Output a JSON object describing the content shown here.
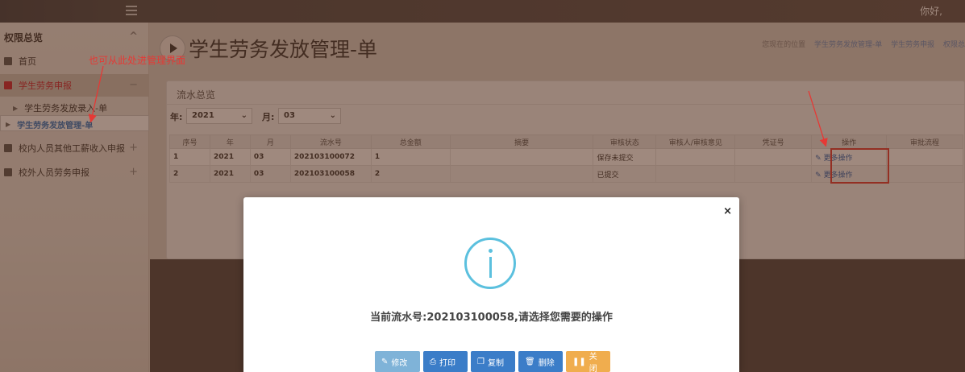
{
  "topbar": {
    "greeting": "你好,"
  },
  "sidebar": {
    "section_title": "权限总览",
    "items": [
      {
        "label": "首页"
      },
      {
        "label": "学生劳务申报"
      },
      {
        "label": "学生劳务发放录入-单"
      },
      {
        "label": "学生劳务发放管理-单"
      },
      {
        "label": "校内人员其他工薪收入申报"
      },
      {
        "label": "校外人员劳务申报"
      }
    ],
    "collapse_symbol": "^",
    "minus_symbol": "−",
    "plus_symbol": "+"
  },
  "annotation": {
    "text": "也可从此处进管理界面"
  },
  "header": {
    "title": "学生劳务发放管理-单",
    "location_label": "您现在的位置",
    "breadcrumbs": [
      "学生劳务发放管理-单",
      "学生劳务申报",
      "权限总"
    ]
  },
  "panel": {
    "title": "流水总览",
    "year_label": "年:",
    "year_value": "2021",
    "month_label": "月:",
    "month_value": "03"
  },
  "table": {
    "headers": [
      "序号",
      "年",
      "月",
      "流水号",
      "总金额",
      "摘要",
      "审核状态",
      "审核人/审核意见",
      "凭证号",
      "操作",
      "审批流程"
    ],
    "rows": [
      [
        "1",
        "2021",
        "03",
        "202103100072",
        "1",
        "",
        "保存未提交",
        "",
        "",
        "更多操作",
        ""
      ],
      [
        "2",
        "2021",
        "03",
        "202103100058",
        "2",
        "",
        "已提交",
        "",
        "",
        "更多操作",
        ""
      ]
    ]
  },
  "modal": {
    "close": "×",
    "message": "当前流水号:202103100058,请选择您需要的操作",
    "buttons": {
      "edit": "修改",
      "print": "打印",
      "copy": "复制",
      "delete": "删除",
      "close": "关闭"
    }
  },
  "colors": {
    "accent_red": "#e53935",
    "info_blue": "#5bc0de",
    "primary": "#3b7dc8",
    "warning": "#f0ad4e"
  }
}
